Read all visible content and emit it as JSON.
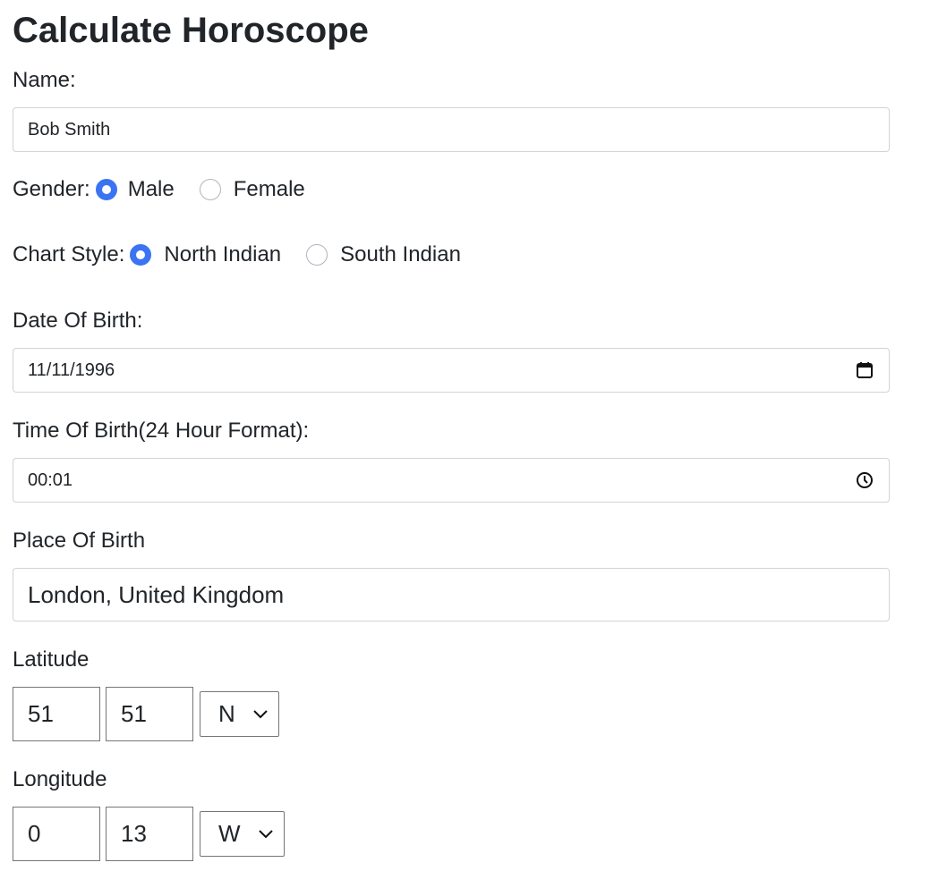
{
  "page_title": "Calculate Horoscope",
  "name": {
    "label": "Name:",
    "value": "Bob Smith"
  },
  "gender": {
    "label": "Gender:",
    "options": [
      {
        "label": "Male",
        "checked": true
      },
      {
        "label": "Female",
        "checked": false
      }
    ]
  },
  "chart_style": {
    "label": "Chart Style:",
    "options": [
      {
        "label": "North Indian",
        "checked": true
      },
      {
        "label": "South Indian",
        "checked": false
      }
    ]
  },
  "date_of_birth": {
    "label": "Date Of Birth:",
    "value": "11/11/1996",
    "icon": "calendar-icon"
  },
  "time_of_birth": {
    "label": "Time Of Birth(24 Hour Format):",
    "value": "00:01",
    "icon": "clock-icon"
  },
  "place_of_birth": {
    "label": "Place Of Birth",
    "value": "London, United Kingdom"
  },
  "latitude": {
    "label": "Latitude",
    "degrees": "51",
    "minutes": "51",
    "direction": "N"
  },
  "longitude": {
    "label": "Longitude",
    "degrees": "0",
    "minutes": "13",
    "direction": "W"
  },
  "colors": {
    "accent": "#3b74f2",
    "border": "#ced4da",
    "text": "#212529"
  }
}
